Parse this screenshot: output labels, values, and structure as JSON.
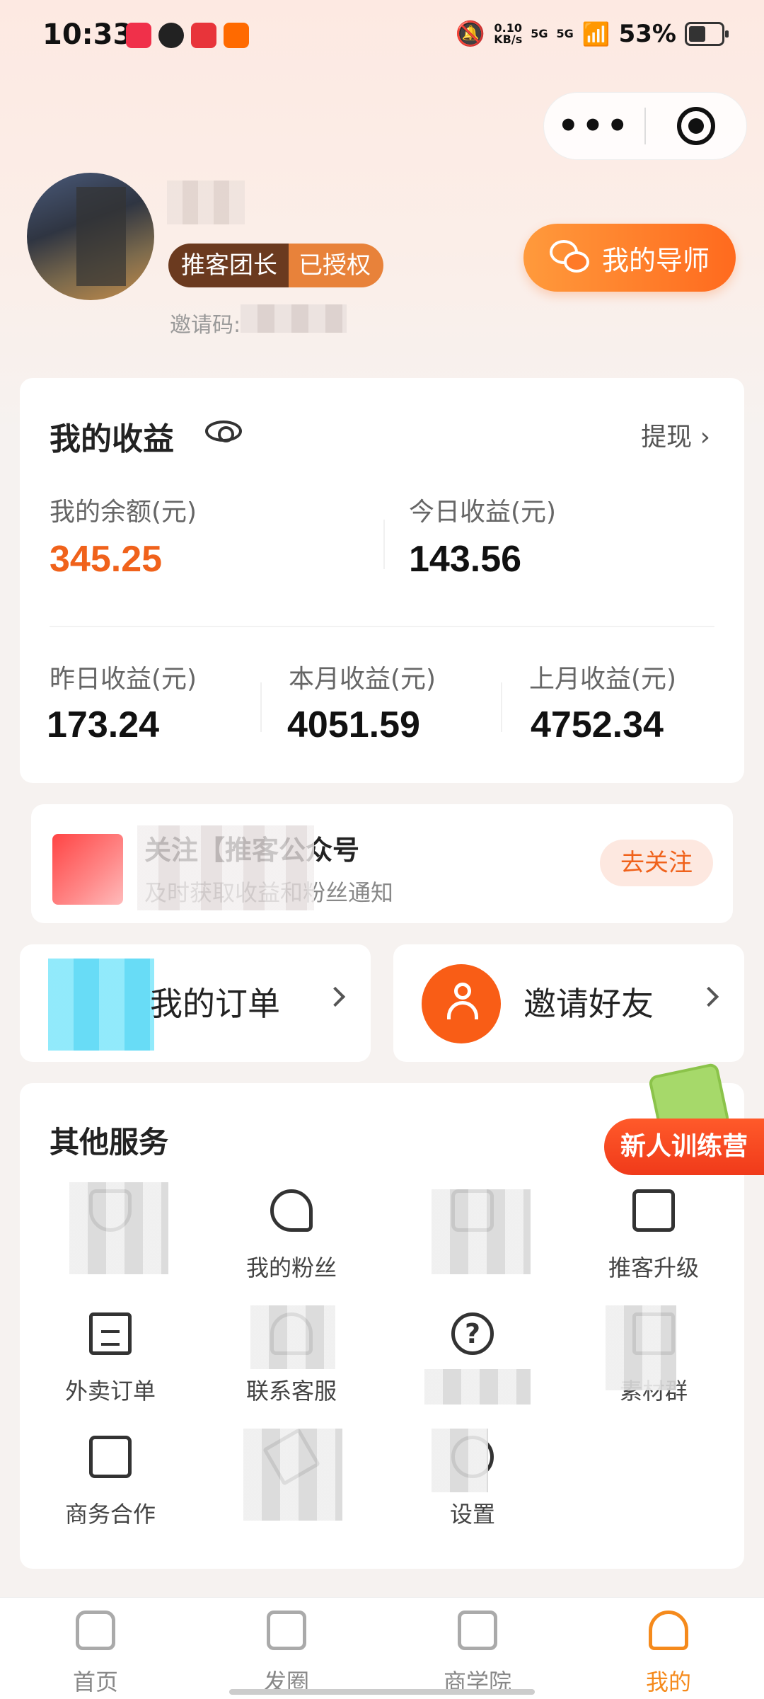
{
  "status_bar": {
    "time": "10:33",
    "network_speed_value": "0.10",
    "network_speed_unit": "KB/s",
    "signal1": "5G",
    "signal2": "5G",
    "battery": "53%"
  },
  "capsule": {
    "more_icon": "•••"
  },
  "profile": {
    "name": "",
    "role_left": "推客团长",
    "role_right": "已授权",
    "invite_code_label": "邀请码: 5",
    "mentor_button": "我的导师"
  },
  "earnings": {
    "title": "我的收益",
    "withdraw": "提现 ›",
    "balance_label": "我的余额(元)",
    "balance_value": "345.25",
    "today_label": "今日收益(元)",
    "today_value": "143.56",
    "yesterday_label": "昨日收益(元)",
    "yesterday_value": "173.24",
    "month_label": "本月收益(元)",
    "month_value": "4051.59",
    "last_month_label": "上月收益(元)",
    "last_month_value": "4752.34"
  },
  "follow": {
    "title": "关注【推客公众号",
    "subtitle": "及时获取收益和粉丝通知",
    "button": "去关注"
  },
  "quick": {
    "orders": "我的订单",
    "invite": "邀请好友"
  },
  "services": {
    "title": "其他服务",
    "badge": "新人训练营",
    "items": [
      {
        "label": ""
      },
      {
        "label": "我的粉丝"
      },
      {
        "label": ""
      },
      {
        "label": "推客升级"
      },
      {
        "label": "外卖订单"
      },
      {
        "label": "联系客服"
      },
      {
        "label": ""
      },
      {
        "label": "素材群"
      },
      {
        "label": "商务合作"
      },
      {
        "label": ""
      },
      {
        "label": "设置"
      }
    ]
  },
  "tabbar": {
    "tabs": [
      {
        "label": "首页"
      },
      {
        "label": "发圈"
      },
      {
        "label": "商学院"
      },
      {
        "label": "我的"
      }
    ]
  },
  "colors": {
    "accent": "#f0621b",
    "tab_active": "#f58a1c"
  }
}
